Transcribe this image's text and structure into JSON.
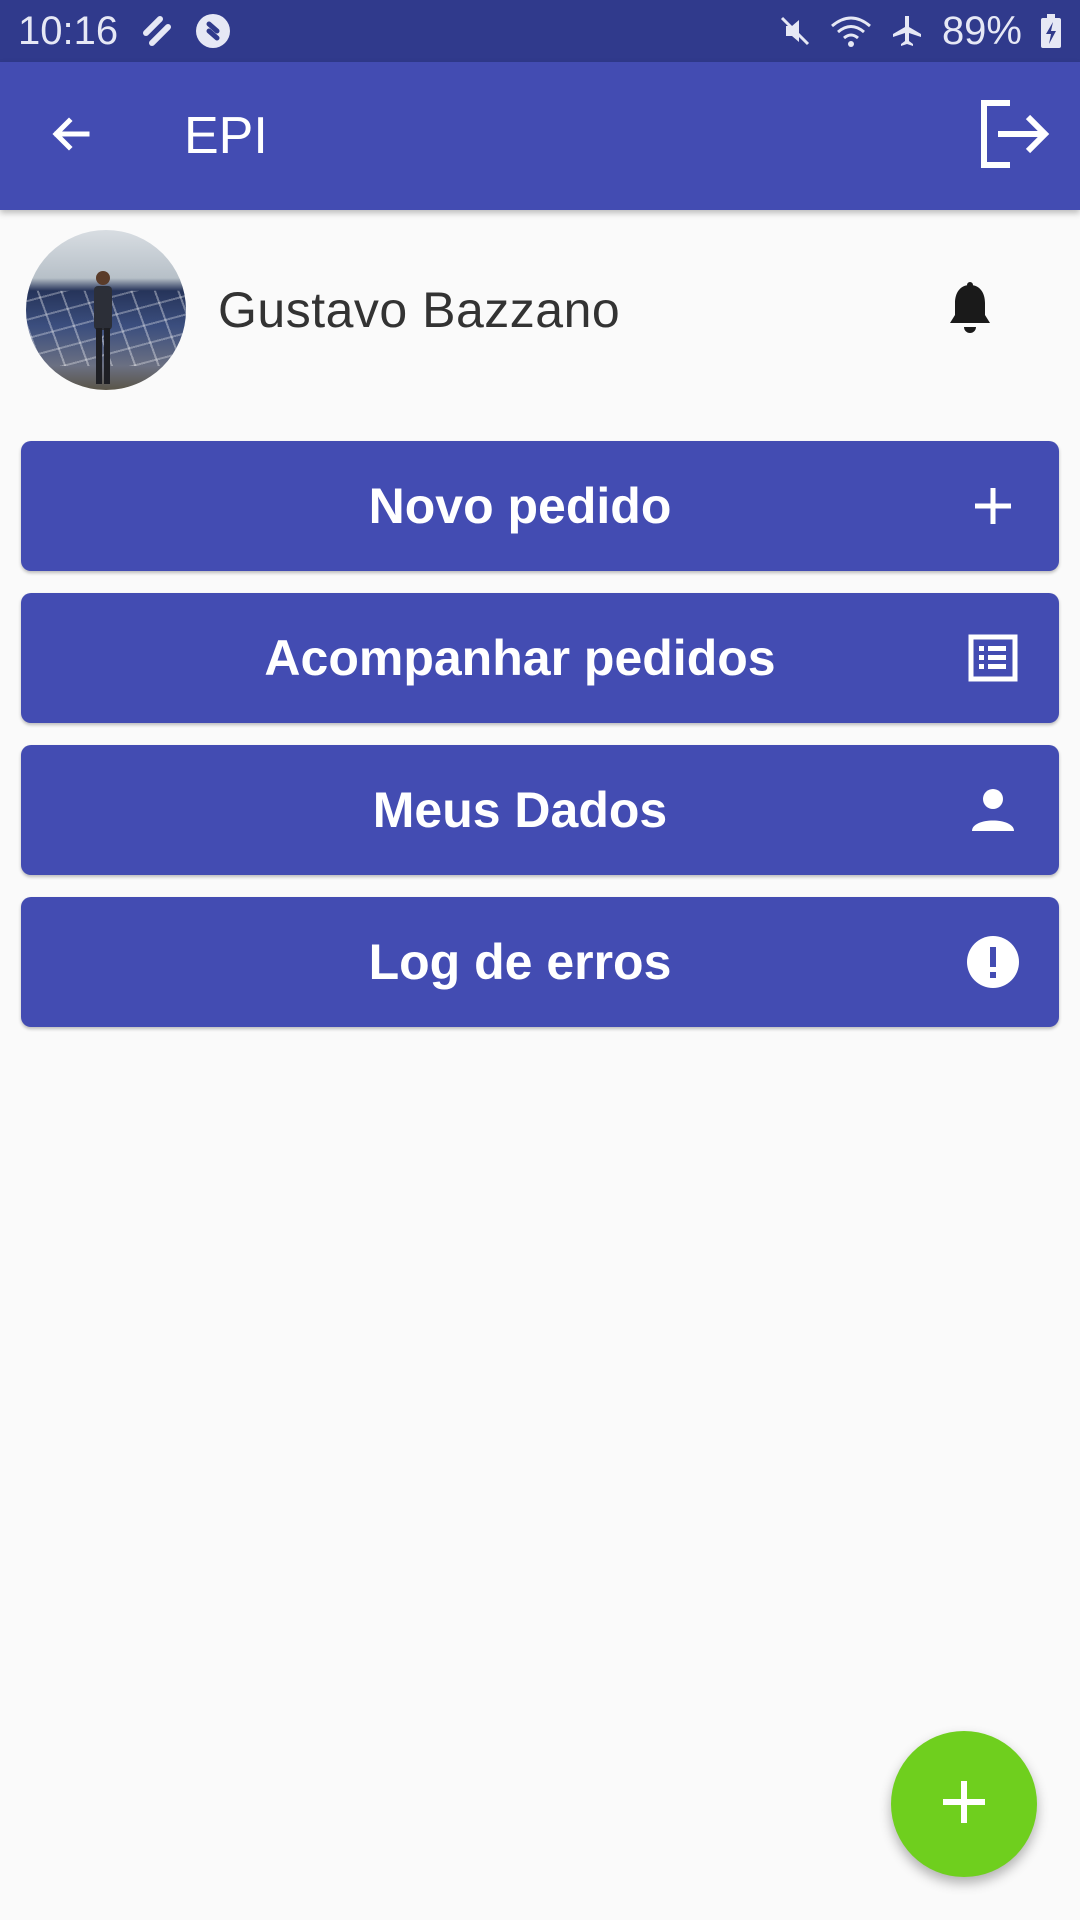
{
  "status_bar": {
    "time": "10:16",
    "battery": "89%",
    "icons": [
      "slack-like-icon",
      "shazam-icon",
      "mute-icon",
      "wifi-icon",
      "airplane-icon",
      "battery-charging-icon"
    ]
  },
  "app_bar": {
    "title": "EPI",
    "back_icon": "arrow-left-icon",
    "logout_icon": "logout-icon"
  },
  "profile": {
    "name": "Gustavo Bazzano",
    "bell_icon": "bell-icon"
  },
  "menu": [
    {
      "label": "Novo pedido",
      "icon": "plus-icon"
    },
    {
      "label": "Acompanhar pedidos",
      "icon": "list-icon"
    },
    {
      "label": "Meus Dados",
      "icon": "person-icon"
    },
    {
      "label": "Log de erros",
      "icon": "alert-icon"
    }
  ],
  "fab": {
    "icon": "plus-icon"
  },
  "colors": {
    "status_bar": "#303a8c",
    "primary": "#434cb2",
    "fab": "#6fcf1e",
    "background": "#fafafa"
  }
}
